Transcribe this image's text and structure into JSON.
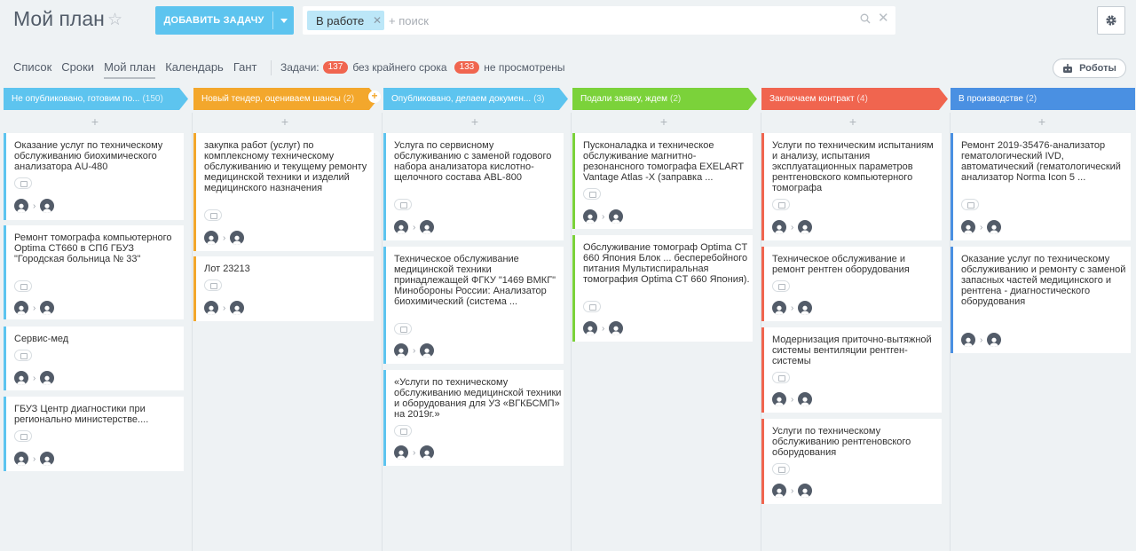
{
  "header": {
    "title": "Мой план",
    "star_icon": "star-icon",
    "add_task_label": "ДОБАВИТЬ ЗАДАЧУ",
    "search": {
      "filter_chip": "В работе",
      "placeholder": "+ поиск"
    },
    "settings_icon": "gear-icon"
  },
  "toolbar": {
    "views": [
      "Список",
      "Сроки",
      "Мой план",
      "Календарь",
      "Гант"
    ],
    "active_view": "Мой план",
    "counters_label": "Задачи:",
    "no_deadline_count": "137",
    "no_deadline_label": "без крайнего срока",
    "not_viewed_count": "133",
    "not_viewed_label": "не просмотрены",
    "robots_label": "Роботы"
  },
  "colors": {
    "accent": "#5dc4ef",
    "badge_red": "#f0654f",
    "avatar": "#535c69"
  },
  "columns": [
    {
      "title": "Не опубликовано, готовим по...",
      "count": "(150)",
      "color": "#5dc4ef",
      "cards": [
        {
          "title": "Оказание услуг по техническому обслуживанию биохимического анализатора AU-480"
        },
        {
          "title": "Ремонт томографа компьютерного Optima CT660 в СПб ГБУЗ \"Городская больница № 33\""
        },
        {
          "title": "Сервис-мед"
        },
        {
          "title": "ГБУЗ Центр диагностики при регионально министерстве...."
        }
      ]
    },
    {
      "title": "Новый тендер, оцениваем шансы",
      "count": "(2)",
      "color": "#f3a72c",
      "cards": [
        {
          "title": "закупка работ (услуг) по комплексному техническому обслуживанию и текущему ремонту медицинской техники и изделий медицинского назначения"
        },
        {
          "title": "Лот 23213"
        }
      ]
    },
    {
      "title": "Опубликовано, делаем докумен...",
      "count": "(3)",
      "color": "#5dc4ef",
      "cards": [
        {
          "title": "Услуга по сервисному обслуживанию с заменой годового набора анализатора кислотно-щелочного состава ABL-800"
        },
        {
          "title": "Техническое обслуживание медицинской техники принадлежащей ФГКУ \"1469 ВМКГ\" Минобороны России: Анализатор биохимический (система ..."
        },
        {
          "title": "«Услуги по техническому обслуживанию медицинской техники и оборудования для УЗ «ВГКБСМП» на 2019г.»"
        }
      ]
    },
    {
      "title": "Подали заявку, ждем",
      "count": "(2)",
      "color": "#7bd23a",
      "cards": [
        {
          "title": "Пусконаладка и техническое обслуживание магнитно-резонансного томографа EXELART Vantage Atlas -X (заправка ..."
        },
        {
          "title": "Обслуживание томограф Optima CT 660 Япония Блок ... бесперебойного питания Мультиспиральная томография Optima CT 660 Япония)."
        }
      ]
    },
    {
      "title": "Заключаем контракт",
      "count": "(4)",
      "color": "#f0654f",
      "cards": [
        {
          "title": "Услуги по техническим испытаниям и анализу, испытания эксплуатационных параметров рентгеновского компьютерного томографа"
        },
        {
          "title": "Техническое обслуживание и ремонт рентген оборудования"
        },
        {
          "title": "Модернизация приточно-вытяжной системы вентиляции рентген-системы"
        },
        {
          "title": "Услуги по техническому обслуживанию рентгеновского оборудования"
        }
      ]
    },
    {
      "title": "В производстве",
      "count": "(2)",
      "color": "#4a90e2",
      "cards": [
        {
          "title": "Ремонт 2019-35476-анализатор гематологический IVD, автоматический (гематологический анализатор Norma Icon 5 ..."
        },
        {
          "title": "Оказание услуг по техническому обслуживанию и ремонту с заменой запасных частей медицинского и рентгена - диагностического оборудования"
        }
      ]
    }
  ]
}
